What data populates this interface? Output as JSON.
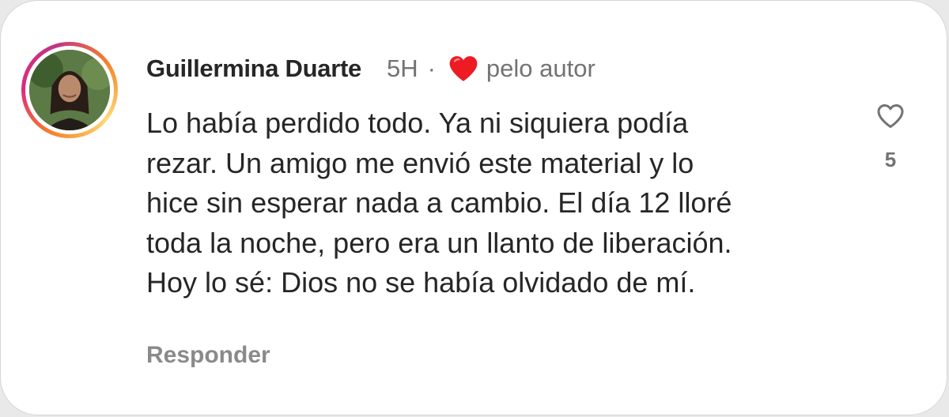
{
  "comment": {
    "author": "Guillermina Duarte",
    "time": "5H",
    "separator": "·",
    "author_badge_icon": "red-heart-icon",
    "author_badge_label": "pelo autor",
    "text": "Lo había perdido todo. Ya ni siquiera podía\nrezar. Un amigo me envió este material y lo\nhice sin esperar nada a cambio. El día 12 lloré\ntoda la noche, pero era un llanto de liberación.\nHoy lo sé: Dios no se había olvidado de mí.",
    "reply_label": "Responder",
    "like_icon": "heart-outline-icon",
    "like_count": "5"
  },
  "colors": {
    "text_primary": "#262626",
    "text_secondary": "#737373",
    "heart_red": "#ed1c24",
    "story_ring_start": "#f58529",
    "story_ring_end": "#dd2a7b"
  }
}
